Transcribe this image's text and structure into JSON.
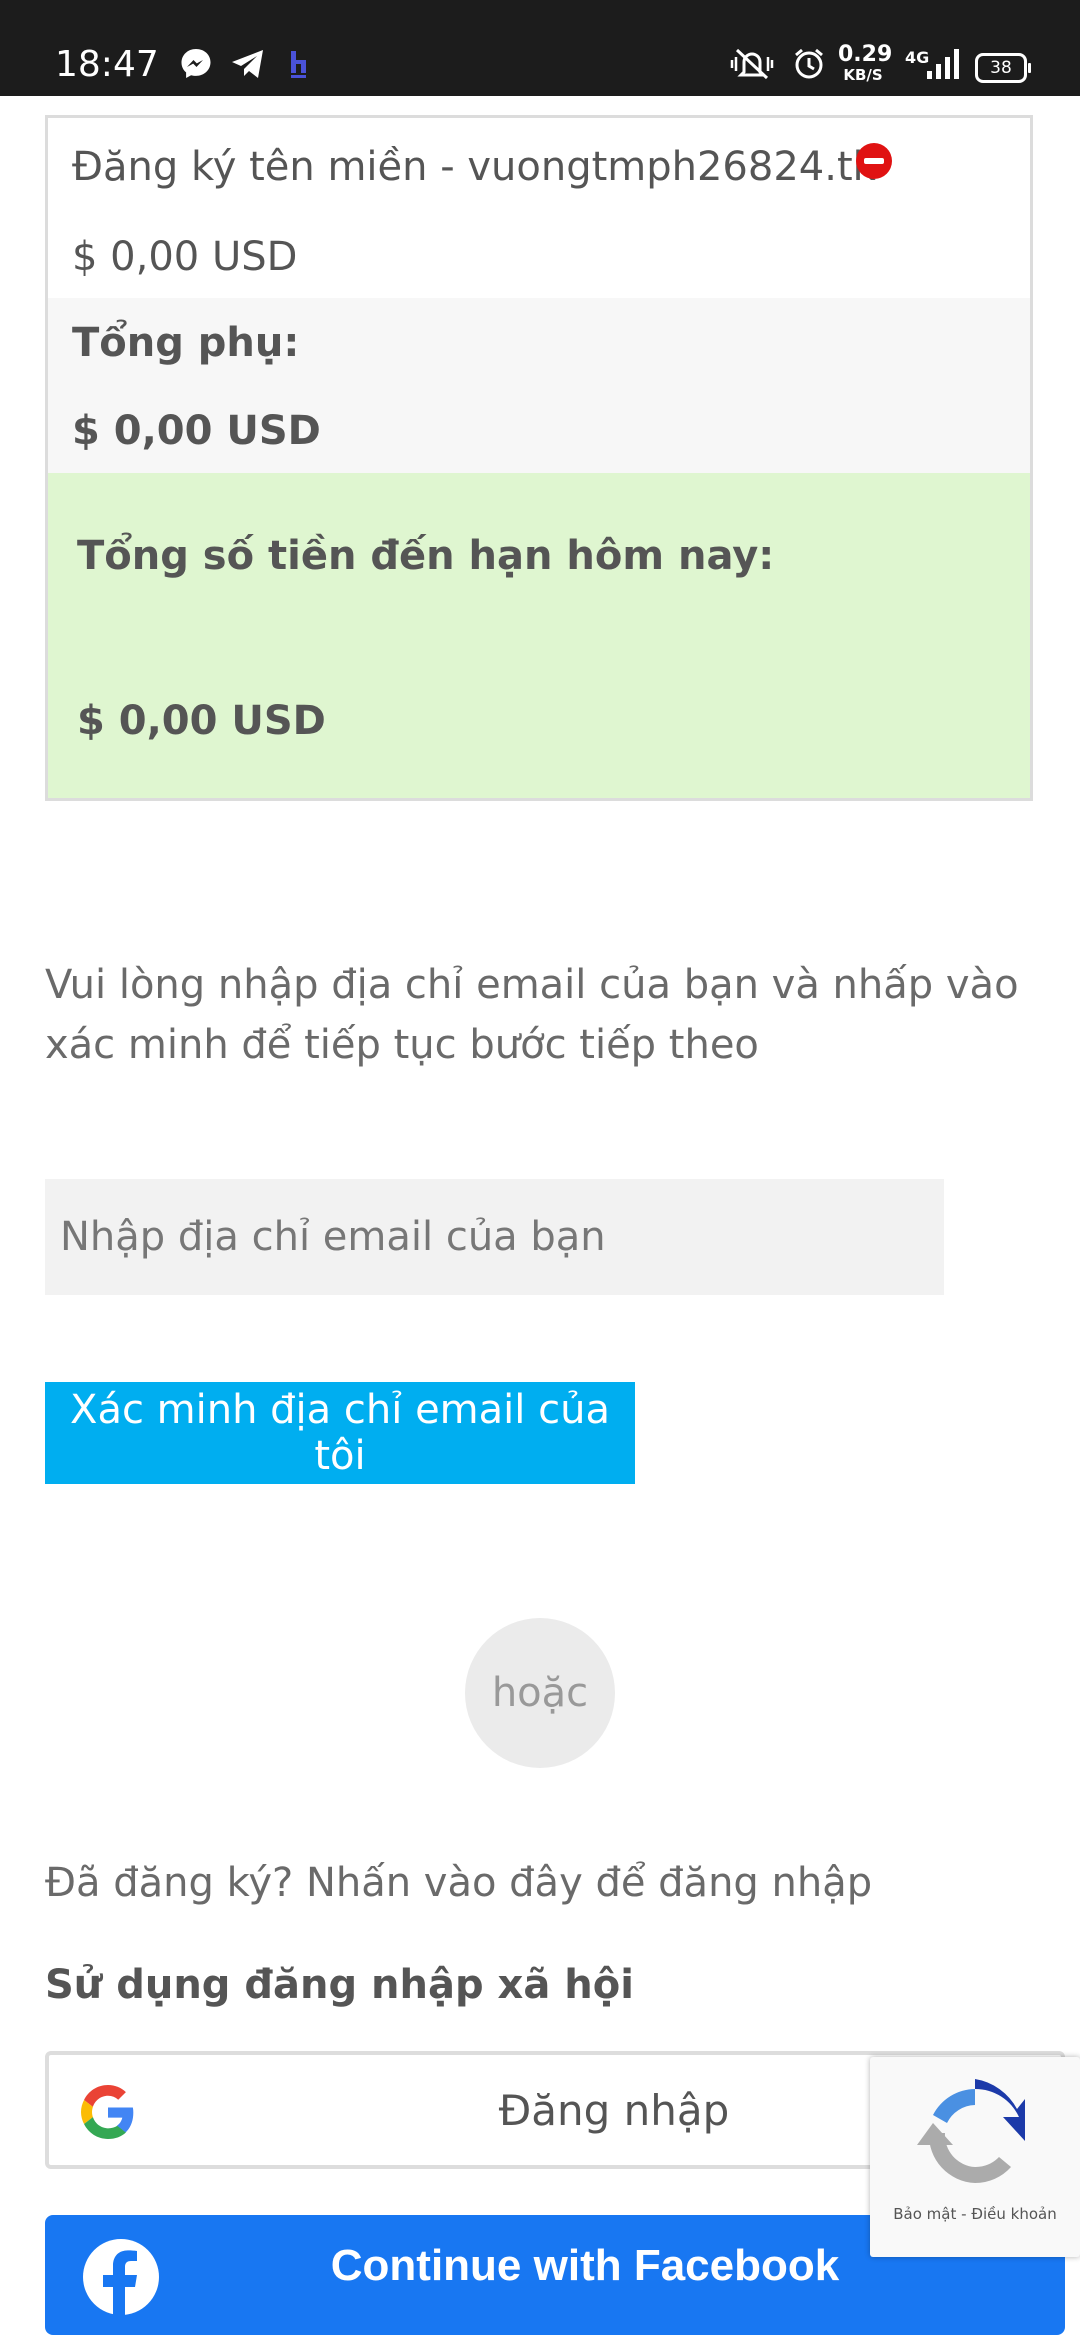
{
  "status_bar": {
    "time": "18:47",
    "speed_value": "0.29",
    "speed_unit": "KB/S",
    "network": "4G",
    "battery": "38",
    "icons": [
      "messenger-icon",
      "telegram-icon",
      "app-icon",
      "mute-icon",
      "alarm-icon",
      "signal-icon",
      "battery-icon"
    ]
  },
  "order": {
    "domain_item": "Đăng ký tên miền - vuongtmph26824.tk",
    "domain_price": "$ 0,00 USD",
    "subtotal_label": "Tổng phụ:",
    "subtotal_value": "$ 0,00 USD",
    "total_label": "Tổng số tiền đến hạn hôm nay:",
    "total_value": "$ 0,00 USD"
  },
  "verify": {
    "instruction": "Vui lòng nhập địa chỉ email của bạn và nhấp vào xác minh để tiếp tục bước tiếp theo",
    "email_placeholder": "Nhập địa chỉ email của bạn",
    "email_value": "",
    "button_label": "Xác minh địa chỉ email của tôi"
  },
  "divider": {
    "or_label": "hoặc"
  },
  "login": {
    "link_text": "Đã đăng ký? Nhấn vào đây để đăng nhập",
    "social_heading": "Sử dụng đăng nhập xã hội",
    "google_label": "Đăng nhập",
    "facebook_label": "Continue with Facebook"
  },
  "recaptcha": {
    "privacy": "Bảo mật",
    "separator": "-",
    "terms": "Điều khoản"
  },
  "colors": {
    "status_bar_bg": "#1c1c1c",
    "total_row_bg": "#dff6d0",
    "verify_button_bg": "#00aef0",
    "facebook_bg": "#1877f2",
    "remove_icon": "#e01212"
  }
}
